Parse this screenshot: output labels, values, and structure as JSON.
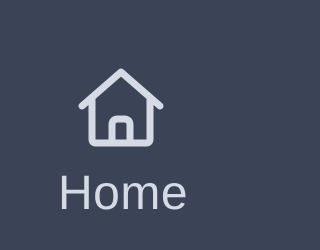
{
  "nav_item": {
    "label": "Home",
    "icon": "home-icon"
  },
  "colors": {
    "background": "#3b4457",
    "foreground": "#d5dae4"
  }
}
